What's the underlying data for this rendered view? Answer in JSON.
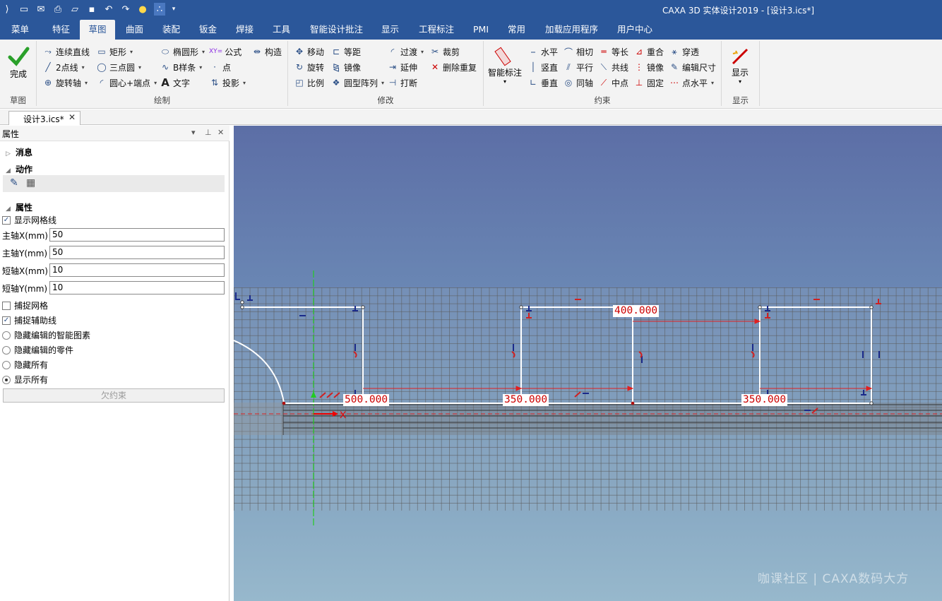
{
  "window": {
    "title": "CAXA 3D 实体设计2019 - [设计3.ics*]"
  },
  "tabs": [
    {
      "label": "菜单"
    },
    {
      "label": "特征"
    },
    {
      "label": "草图"
    },
    {
      "label": "曲面"
    },
    {
      "label": "装配"
    },
    {
      "label": "钣金"
    },
    {
      "label": "焊接"
    },
    {
      "label": "工具"
    },
    {
      "label": "智能设计批注"
    },
    {
      "label": "显示"
    },
    {
      "label": "工程标注"
    },
    {
      "label": "PMI"
    },
    {
      "label": "常用"
    },
    {
      "label": "加载应用程序"
    },
    {
      "label": "用户中心"
    }
  ],
  "ribbon": {
    "finish": {
      "label": "完成",
      "group": "草图"
    },
    "draw": {
      "group": "绘制",
      "items": [
        "连续直线",
        "矩形",
        "椭圆形",
        "公式",
        "构造",
        "2点线",
        "三点圆",
        "B样条",
        "点",
        "旋转轴",
        "圆心+端点",
        "文字",
        "投影"
      ],
      "formula_icon": "XY="
    },
    "modify": {
      "group": "修改",
      "items": [
        "移动",
        "等距",
        "过渡",
        "裁剪",
        "旋转",
        "镜像",
        "延伸",
        "删除重复",
        "比例",
        "圆型阵列",
        "打断"
      ]
    },
    "constraint": {
      "group": "约束",
      "smart": "智能标注",
      "items": [
        "水平",
        "相切",
        "等长",
        "重合",
        "穿透",
        "竖直",
        "平行",
        "共线",
        "镜像",
        "编辑尺寸",
        "垂直",
        "同轴",
        "中点",
        "固定",
        "点水平"
      ]
    },
    "display": {
      "group": "显示",
      "label": "显示"
    }
  },
  "doc_tab": {
    "label": "设计3.ics*"
  },
  "panel": {
    "title": "属性",
    "sections": {
      "message": "消息",
      "action": "动作",
      "props": "属性"
    },
    "show_grid": {
      "label": "显示网格线",
      "checked": true
    },
    "fields": [
      {
        "label": "主轴X(mm)",
        "value": "50"
      },
      {
        "label": "主轴Y(mm)",
        "value": "50"
      },
      {
        "label": "短轴X(mm)",
        "value": "10"
      },
      {
        "label": "短轴Y(mm)",
        "value": "10"
      }
    ],
    "snap_grid": {
      "label": "捕捉网格",
      "checked": false
    },
    "snap_aux": {
      "label": "捕捉辅助线",
      "checked": true
    },
    "radios": [
      {
        "label": "隐藏编辑的智能图素",
        "selected": false
      },
      {
        "label": "隐藏编辑的零件",
        "selected": false
      },
      {
        "label": "隐藏所有",
        "selected": false
      },
      {
        "label": "显示所有",
        "selected": true
      }
    ],
    "under_constraint_button": "欠约束"
  },
  "viewport": {
    "dimensions": [
      "500.000",
      "350.000",
      "400.000",
      "350.000"
    ],
    "axis_label": "X",
    "watermark": "咖课社区 | CAXA数码大方"
  },
  "colors": {
    "accent": "#2b579a",
    "dim_red": "#cc0000",
    "constraint_blue": "#1a2a8a",
    "axis_green": "#22cc22"
  }
}
